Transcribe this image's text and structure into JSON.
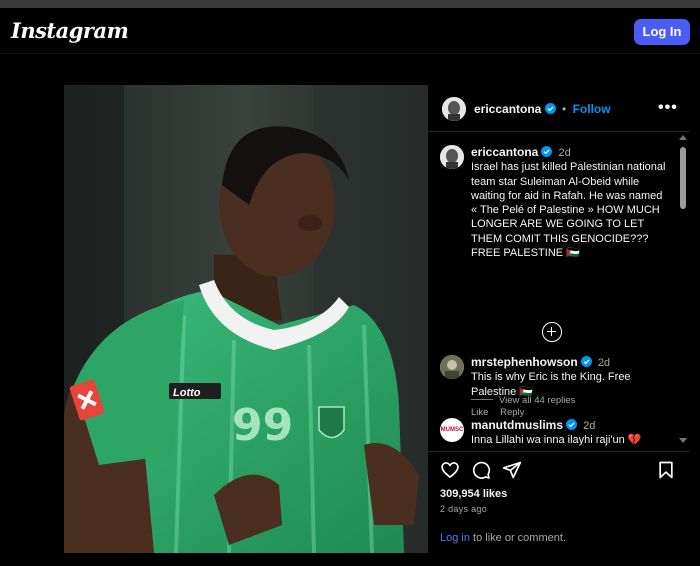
{
  "header": {
    "logo": "Instagram",
    "login_button": "Log In"
  },
  "post": {
    "author": "ericcantona",
    "follow_label": "Follow",
    "more_label": "•••"
  },
  "caption": {
    "username": "ericcantona",
    "time": "2d",
    "text": "Israel has just killed Palestinian national team star Suleiman Al-Obeid while waiting for aid in Rafah. He was named « The Pelé of Palestine » HOW MUCH LONGER ARE WE GOING TO LET THEM COMIT THIS GENOCIDE??? FREE PALESTINE 🇵🇸"
  },
  "comments": [
    {
      "username": "mrstephenhowson",
      "time": "2d",
      "text": "This is why Eric is the King. Free Palestine 🇵🇸",
      "like_label": "Like",
      "reply_label": "Reply",
      "view_replies": "View all 44 replies"
    },
    {
      "username": "manutdmuslims",
      "avatar_text": "MUMSC",
      "time": "2d",
      "text": "Inna Lillahi wa inna ilayhi raji'un 💔"
    }
  ],
  "actions": {
    "likes": "309,954 likes",
    "posted_ago": "2 days ago",
    "login_link": "Log in",
    "login_suffix": " to like or comment."
  },
  "photo": {
    "shirt_number": "99",
    "shirt_brand": "Lotto"
  },
  "colors": {
    "accent_blue": "#0095f6",
    "login_button_bg": "#4a5df9",
    "jersey_green": "#2fa46a",
    "background": "#000000"
  }
}
